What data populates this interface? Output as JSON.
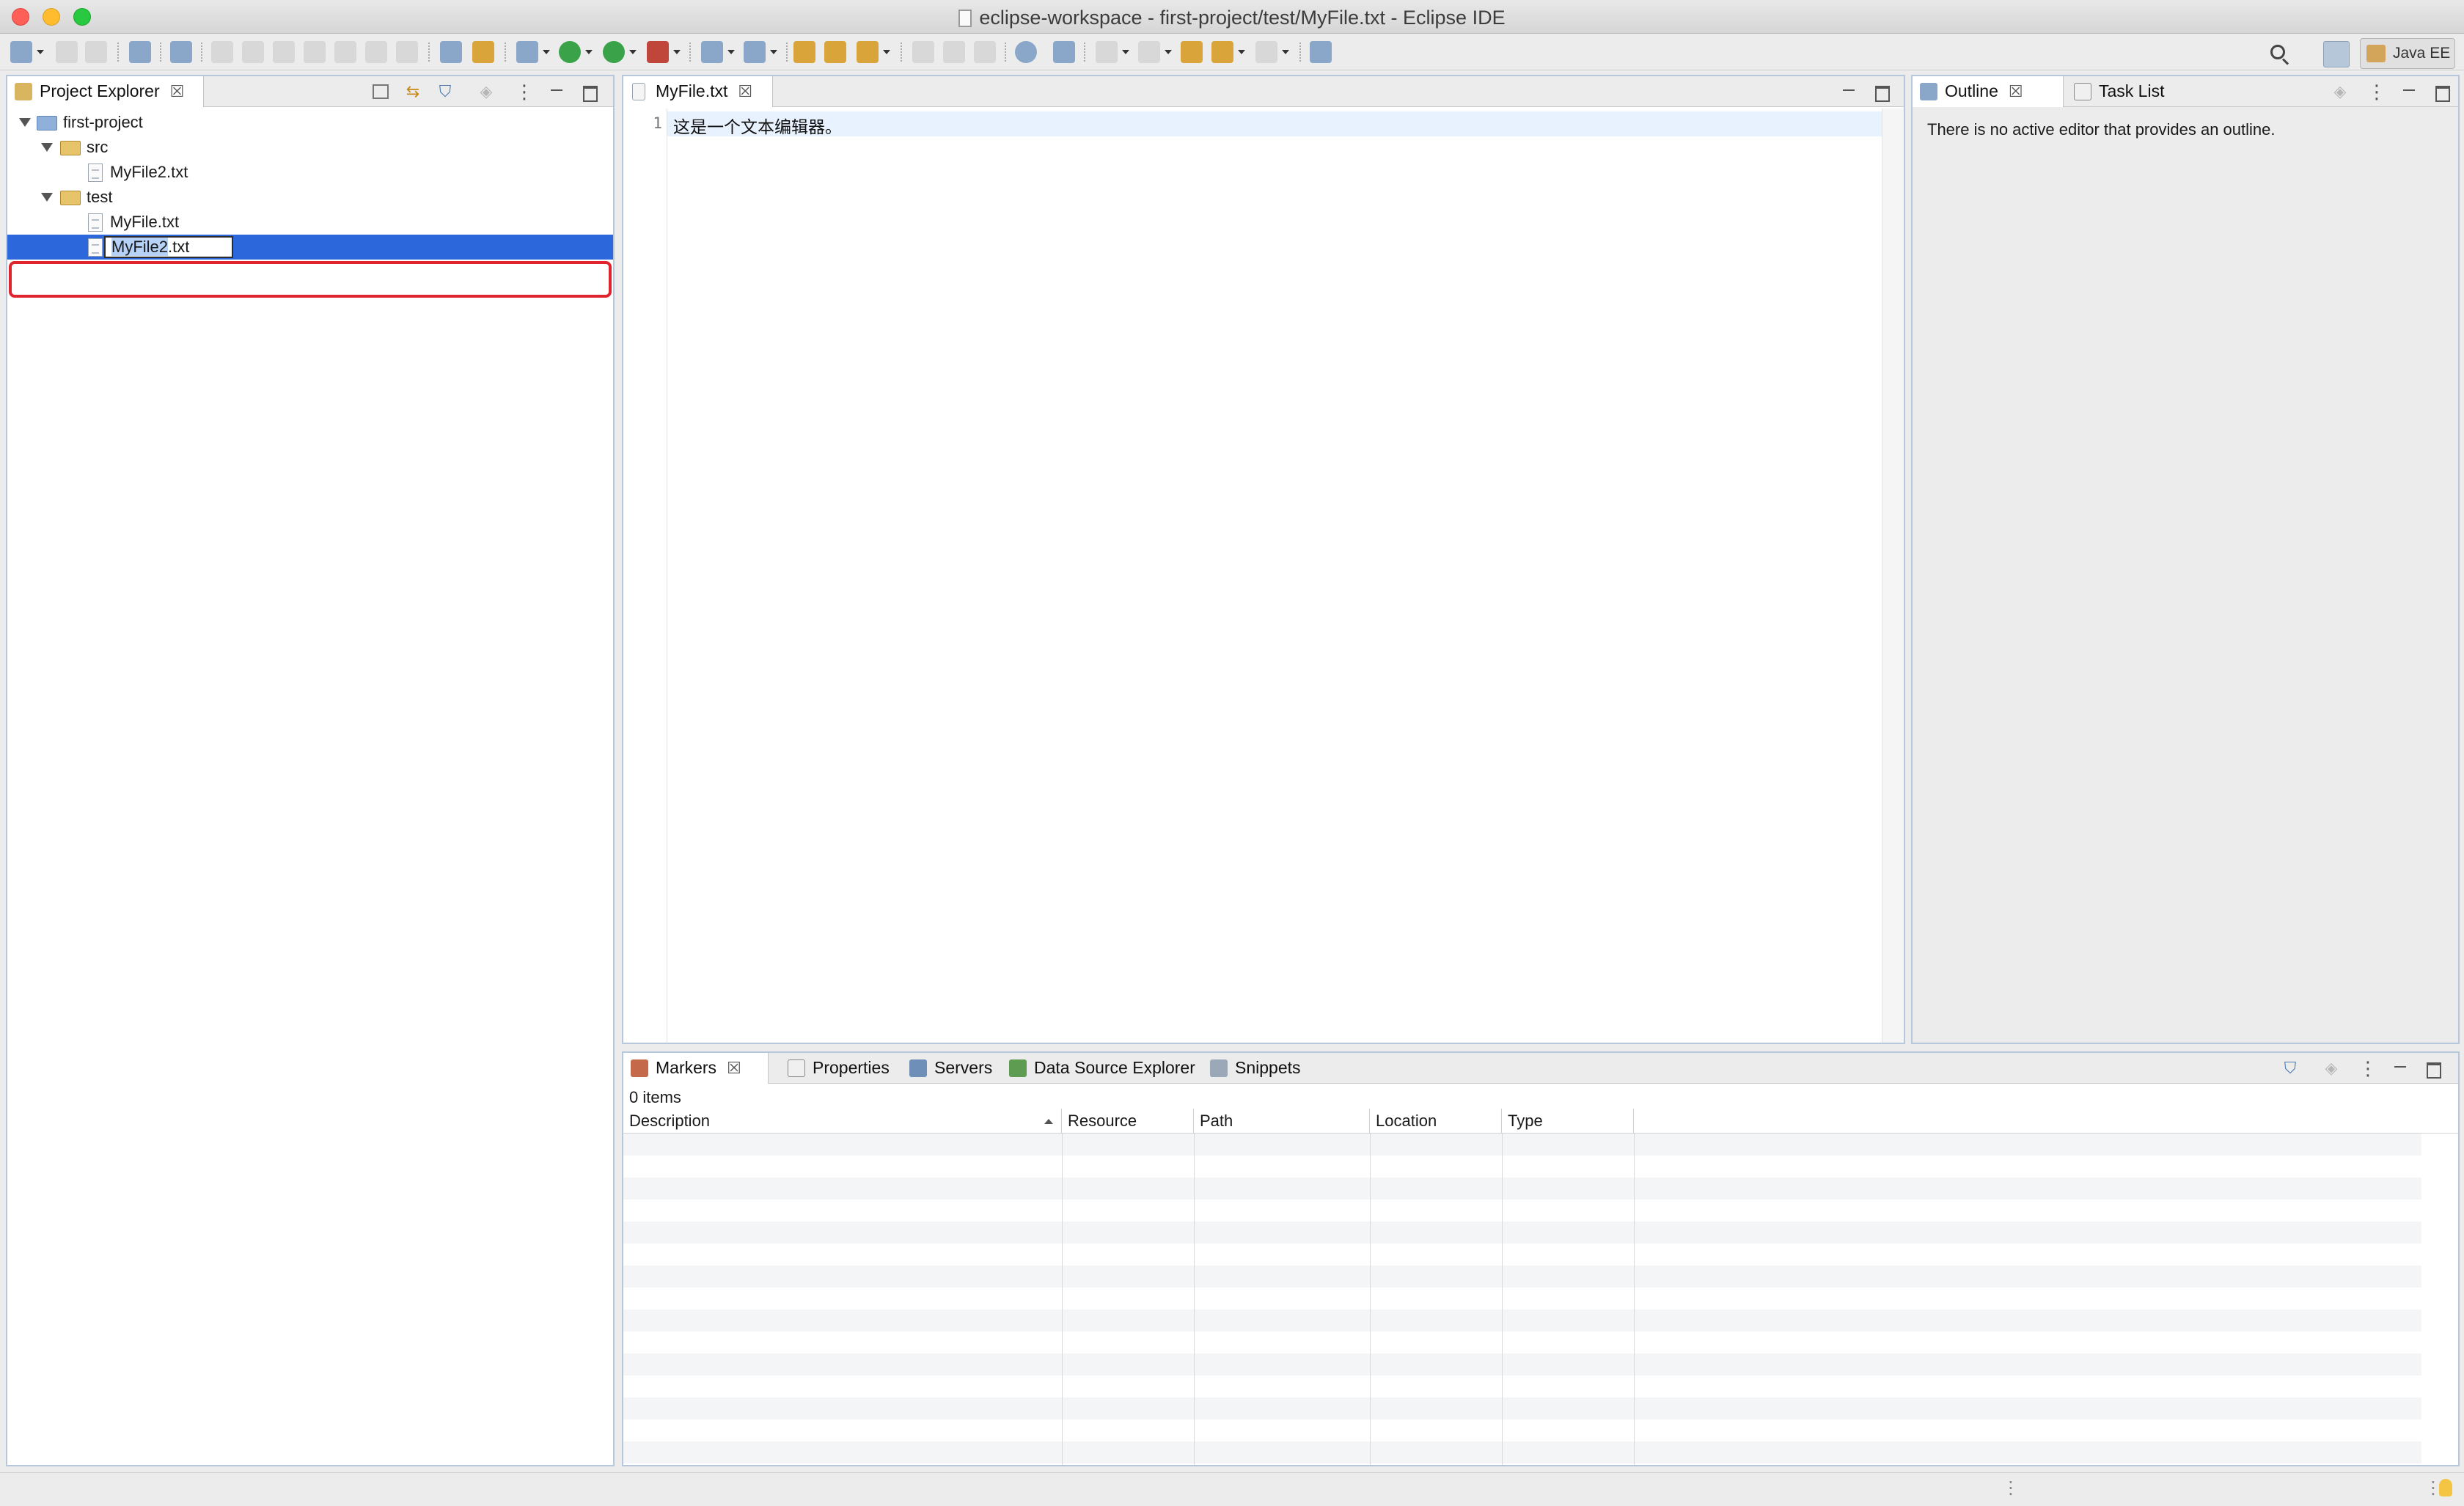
{
  "window": {
    "title": "eclipse-workspace - first-project/test/MyFile.txt - Eclipse IDE"
  },
  "toolbar": {
    "perspective_label": "Java EE"
  },
  "project_explorer": {
    "tab_label": "Project Explorer",
    "tree": {
      "project": "first-project",
      "src_folder": "src",
      "src_file": "MyFile2.txt",
      "test_folder": "test",
      "test_file": "MyFile.txt",
      "rename_selected": "MyFile2",
      "rename_suffix": ".txt"
    }
  },
  "editor": {
    "tab_label": "MyFile.txt",
    "line_number": "1",
    "line_text": "这是一个文本编辑器。"
  },
  "outline": {
    "tabs": [
      "Outline",
      "Task List"
    ],
    "message": "There is no active editor that provides an outline."
  },
  "markers": {
    "tabs": [
      "Markers",
      "Properties",
      "Servers",
      "Data Source Explorer",
      "Snippets"
    ],
    "items_count": "0 items",
    "columns": [
      "Description",
      "Resource",
      "Path",
      "Location",
      "Type"
    ]
  },
  "colors": {
    "selection": "#2c67db",
    "highlight_frame": "#e0242d",
    "current_line": "#e8f2fe"
  },
  "icons": [
    "new-icon",
    "save-icon",
    "run-icon",
    "debug-icon",
    "search-icon",
    "folder-icon",
    "file-icon",
    "close-icon",
    "minimize-icon",
    "maximize-icon",
    "filter-icon",
    "bulb-icon"
  ]
}
